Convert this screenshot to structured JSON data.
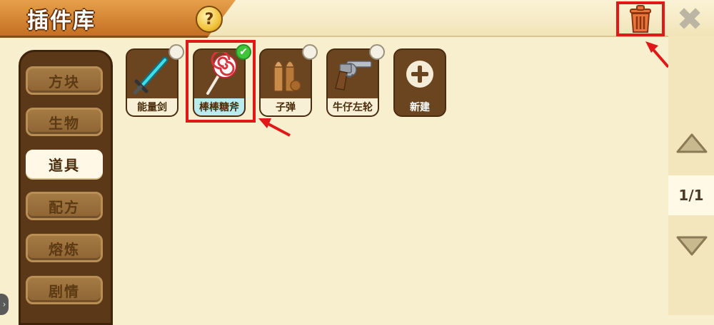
{
  "window": {
    "title": "插件库",
    "help_label": "?",
    "close_label": "✖"
  },
  "sidebar": {
    "items": [
      {
        "label": "方块",
        "active": false
      },
      {
        "label": "生物",
        "active": false
      },
      {
        "label": "道具",
        "active": true
      },
      {
        "label": "配方",
        "active": false
      },
      {
        "label": "熔炼",
        "active": false
      },
      {
        "label": "剧情",
        "active": false
      }
    ]
  },
  "plugins": [
    {
      "label": "能量剑",
      "icon": "energy-sword-icon",
      "selected": false
    },
    {
      "label": "棒棒糖斧",
      "icon": "lollipop-axe-icon",
      "selected": true
    },
    {
      "label": "子弹",
      "icon": "bullet-icon",
      "selected": false
    },
    {
      "label": "牛仔左轮",
      "icon": "revolver-icon",
      "selected": false
    },
    {
      "label": "新建",
      "icon": "plus-icon",
      "selected": false
    }
  ],
  "pager": {
    "page_text": "1/1"
  },
  "colors": {
    "highlight": "#e01818",
    "accent_orange": "#d07a2c",
    "check_green": "#3fc43a"
  }
}
